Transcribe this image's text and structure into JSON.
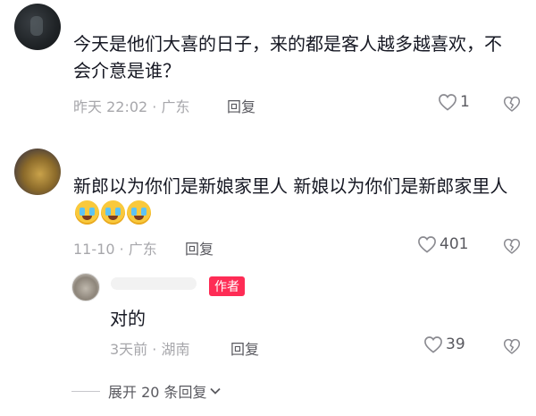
{
  "comments": [
    {
      "text": "今天是他们大喜的日子，来的都是客人越多越喜欢，不会介意是谁？",
      "meta": "昨天 22:02 · 广东",
      "reply_label": "回复",
      "likes": "1"
    },
    {
      "text": "新郎以为你们是新娘家里人 新娘以为你们是新郎家里人",
      "emoji": [
        "laughing-crying-emoji",
        "laughing-crying-emoji",
        "laughing-crying-emoji"
      ],
      "meta": "11-10 · 广东",
      "reply_label": "回复",
      "likes": "401"
    }
  ],
  "reply": {
    "badge": "作者",
    "text": "对的",
    "meta": "3天前 · 湖南",
    "reply_label": "回复",
    "likes": "39"
  },
  "expand": {
    "label": "展开 20 条回复"
  },
  "colors": {
    "author_badge": "#fe2c55",
    "meta": "#a7a7ab",
    "text": "#161823"
  }
}
